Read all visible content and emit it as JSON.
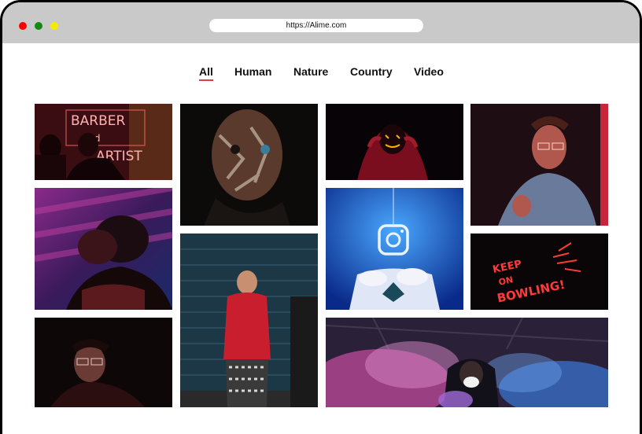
{
  "browser": {
    "url": "https://Alime.com"
  },
  "filters": [
    {
      "label": "All",
      "active": true
    },
    {
      "label": "Human",
      "active": false
    },
    {
      "label": "Nature",
      "active": false
    },
    {
      "label": "Country",
      "active": false
    },
    {
      "label": "Video",
      "active": false
    }
  ],
  "gallery": {
    "items": [
      {
        "subject": "barber neon sign portrait",
        "neon_text": [
          "BARBER",
          "And",
          "ARTIST"
        ]
      },
      {
        "subject": "face with painted cracks"
      },
      {
        "subject": "hooded figure with led mask"
      },
      {
        "subject": "man with glasses in red light"
      },
      {
        "subject": "man looking up in pink light"
      },
      {
        "subject": "instagram neon bed room"
      },
      {
        "subject": "neon sign",
        "neon_text": [
          "KEEP",
          "ON",
          "BOWLING!"
        ]
      },
      {
        "subject": "person in red hoodie looking up"
      },
      {
        "subject": "man in dark with glasses"
      },
      {
        "subject": "hooded person with mask and smoke"
      }
    ]
  },
  "colors": {
    "accent": "#e03a4a",
    "titlebar": "#c9c9c9"
  }
}
